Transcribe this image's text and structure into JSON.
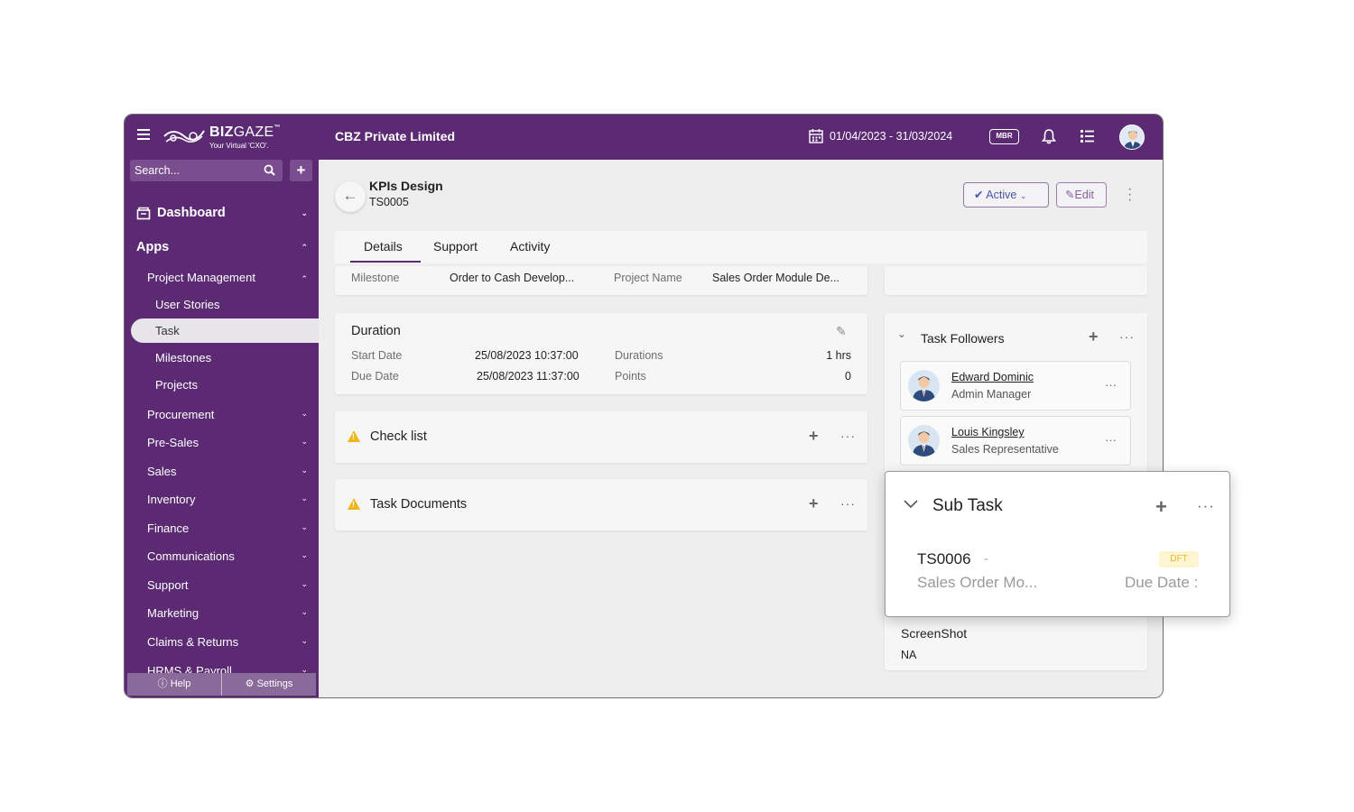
{
  "header": {
    "logo_main": "BIZ",
    "logo_main_light": "GAZE",
    "logo_tm": "™",
    "logo_tagline": "Your Virtual 'CXO'.",
    "company": "CBZ Private Limited",
    "date_range": "01/04/2023 - 31/03/2024",
    "mbr_label": "MBR"
  },
  "sidebar": {
    "search_placeholder": "Search...",
    "add_label": "+",
    "dashboard": "Dashboard",
    "apps": "Apps",
    "project_management": "Project Management",
    "sub_items": [
      "User Stories",
      "Task",
      "Milestones",
      "Projects"
    ],
    "modules": [
      "Procurement",
      "Pre-Sales",
      "Sales",
      "Inventory",
      "Finance",
      "Communications",
      "Support",
      "Marketing",
      "Claims & Returns",
      "HRMS & Payroll"
    ],
    "help": "Help",
    "settings": "Settings"
  },
  "record": {
    "title": "KPIs Design",
    "code": "TS0005",
    "status": "Active",
    "edit": "Edit"
  },
  "tabs": [
    "Details",
    "Support",
    "Activity"
  ],
  "partial_row": {
    "milestone_label": "Milestone",
    "milestone_value": "Order to Cash Develop...",
    "project_label": "Project Name",
    "project_value": "Sales Order Module De..."
  },
  "duration": {
    "title": "Duration",
    "start_label": "Start Date",
    "start_value": "25/08/2023 10:37:00",
    "due_label": "Due Date",
    "due_value": "25/08/2023 11:37:00",
    "durations_label": "Durations",
    "durations_value": "1 hrs",
    "points_label": "Points",
    "points_value": "0"
  },
  "checklist": {
    "title": "Check list"
  },
  "task_documents": {
    "title": "Task Documents"
  },
  "followers": {
    "title": "Task Followers",
    "items": [
      {
        "name": "Edward Dominic",
        "role": "Admin Manager"
      },
      {
        "name": "Louis Kingsley",
        "role": "Sales Representative"
      }
    ]
  },
  "screenshot": {
    "label": "ScreenShot",
    "value": "NA"
  },
  "subtask": {
    "title": "Sub Task",
    "code": "TS0006",
    "dash": "-",
    "badge": "DFT",
    "name": "Sales Order Mo...",
    "due_label": "Due Date :"
  },
  "colors": {
    "brand": "#5b2a73",
    "warning": "#f1b51c",
    "status_text": "#4a55a8"
  }
}
